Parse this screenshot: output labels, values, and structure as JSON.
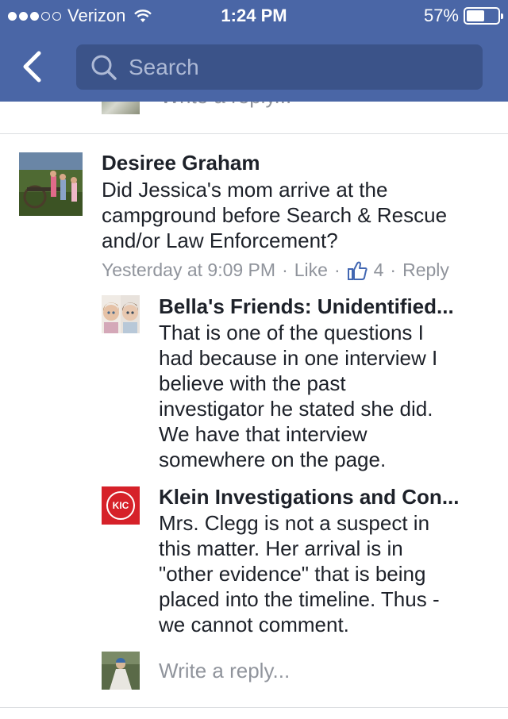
{
  "status_bar": {
    "carrier": "Verizon",
    "time": "1:24 PM",
    "battery": "57%",
    "battery_level": 0.57
  },
  "nav": {
    "search_placeholder": "Search"
  },
  "previous_reply_placeholder": "Write a reply...",
  "comment": {
    "author": "Desiree Graham",
    "text_lines": [
      "Did Jessica's mom arrive at the",
      "campground before Search & Rescue",
      "and/or Law Enforcement?"
    ],
    "timestamp": "Yesterday at 9:09 PM",
    "like_label": "Like",
    "like_count": "4",
    "reply_label": "Reply",
    "separator": "·"
  },
  "replies": [
    {
      "author": "Bella's Friends: Unidentified...",
      "text_lines": [
        "That is one of the questions I",
        "had because in one interview I",
        "believe with the past",
        "investigator he stated she did.",
        "We have that interview",
        "somewhere on the page."
      ]
    },
    {
      "author": "Klein Investigations and Con...",
      "avatar_text": "KIC",
      "text_lines": [
        "Mrs. Clegg is not a suspect in",
        "this matter. Her arrival is in",
        "\"other evidence\" that is being",
        "placed into the timeline. Thus -",
        "we cannot comment."
      ]
    }
  ],
  "write_reply_placeholder": "Write a reply...",
  "colors": {
    "header": "#4a66a6",
    "search_field": "#3b5389",
    "text_primary": "#1d2129",
    "text_secondary": "#90949c",
    "like_blue": "#4267b2",
    "kic_red": "#d62129"
  }
}
